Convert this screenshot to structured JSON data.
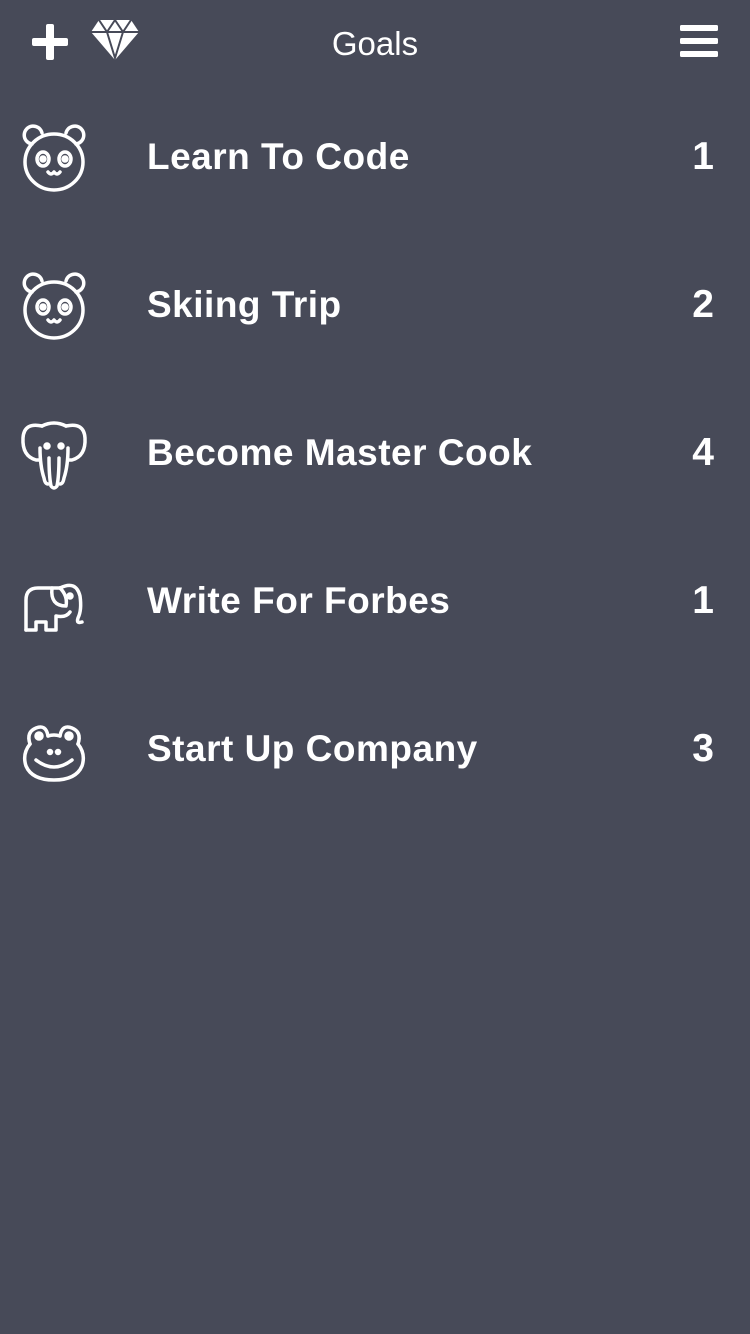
{
  "header": {
    "title": "Goals",
    "add_icon": "plus-icon",
    "premium_icon": "diamond-icon",
    "menu_icon": "hamburger-menu-icon"
  },
  "colors": {
    "background": "#474a58",
    "text": "#ffffff"
  },
  "goals": [
    {
      "name": "Learn To Code",
      "count": "1",
      "icon": "panda-icon"
    },
    {
      "name": "Skiing Trip",
      "count": "2",
      "icon": "panda-icon"
    },
    {
      "name": "Become Master Cook",
      "count": "4",
      "icon": "elephant-front-icon"
    },
    {
      "name": "Write For Forbes",
      "count": "1",
      "icon": "elephant-side-icon"
    },
    {
      "name": "Start Up Company",
      "count": "3",
      "icon": "frog-icon"
    }
  ]
}
